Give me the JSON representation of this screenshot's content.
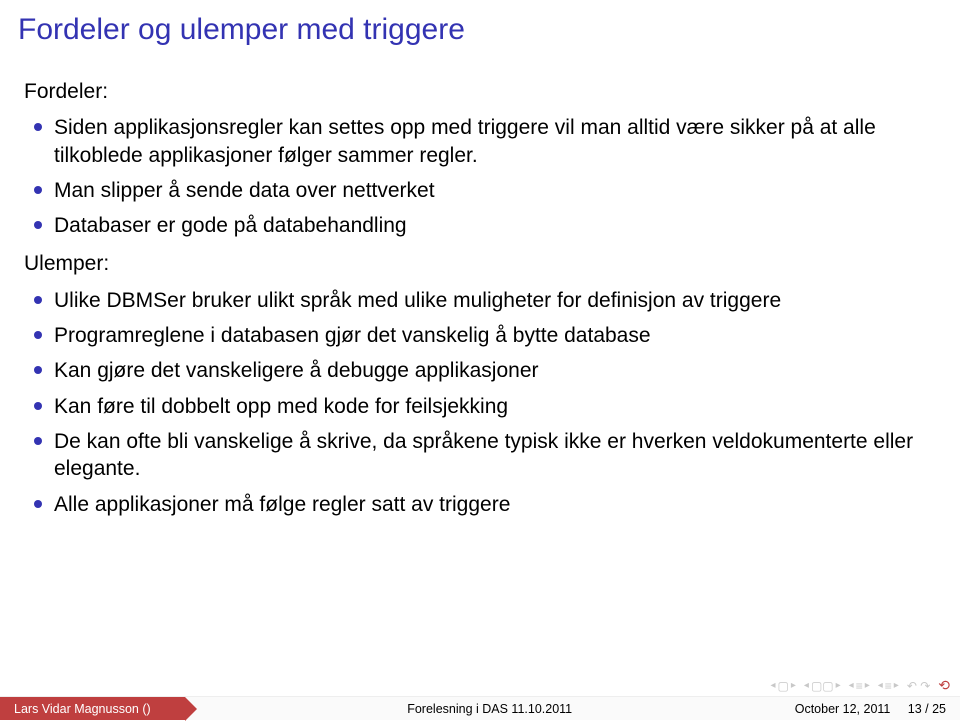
{
  "title": "Fordeler og ulemper med triggere",
  "fordeler": {
    "label": "Fordeler:",
    "items": [
      "Siden applikasjonsregler kan settes opp med triggere vil man alltid være sikker på at alle tilkoblede applikasjoner følger sammer regler.",
      "Man slipper å sende data over nettverket",
      "Databaser er gode på databehandling"
    ]
  },
  "ulemper": {
    "label": "Ulemper:",
    "items": [
      "Ulike DBMSer bruker ulikt språk med ulike muligheter for definisjon av triggere",
      "Programreglene i databasen gjør det vanskelig å bytte database",
      "Kan gjøre det vanskeligere å debugge applikasjoner",
      "Kan føre til dobbelt opp med kode for feilsjekking",
      "De kan ofte bli vanskelige å skrive, da språkene typisk ikke er hverken veldokumenterte eller elegante.",
      "Alle applikasjoner må følge regler satt av triggere"
    ]
  },
  "footer": {
    "author": "Lars Vidar Magnusson ()",
    "lecture": "Forelesning i DAS 11.10.2011",
    "date": "October 12, 2011",
    "page": "13 / 25"
  }
}
